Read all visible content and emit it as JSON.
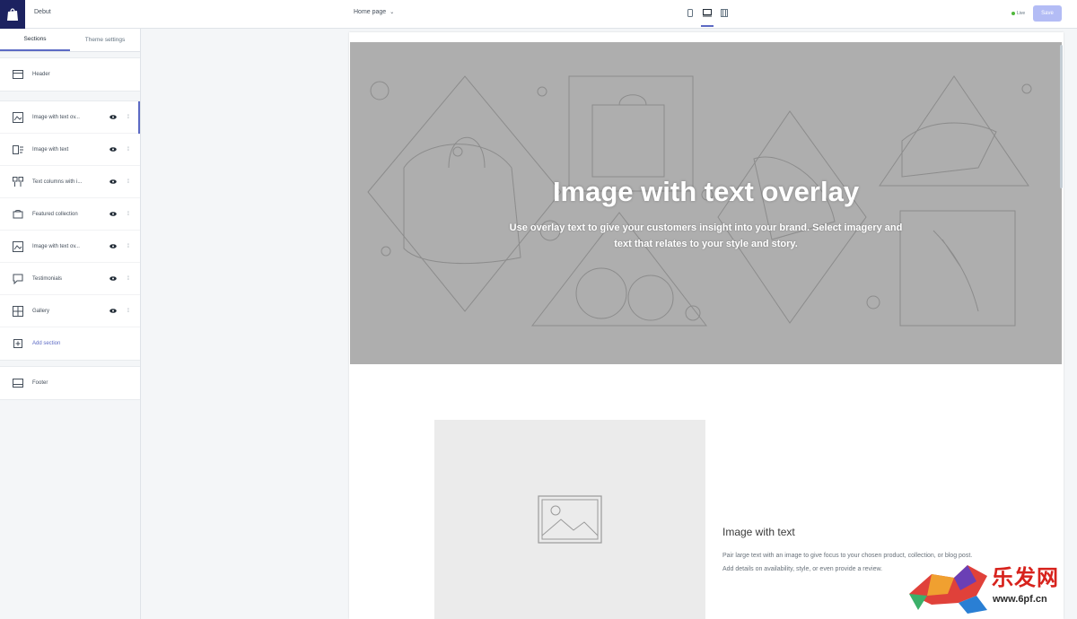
{
  "topbar": {
    "theme_name": "Debut",
    "page_select": "Home page",
    "status": "Live",
    "save_label": "Save",
    "devices": [
      "mobile-icon",
      "desktop-icon",
      "fullscreen-icon"
    ]
  },
  "sidebar": {
    "tabs": [
      "Sections",
      "Theme settings"
    ],
    "header": "Header",
    "sections": [
      {
        "label": "Image with text ov...",
        "icon": "image-text-overlay-icon"
      },
      {
        "label": "Image with text",
        "icon": "image-text-icon"
      },
      {
        "label": "Text columns with i...",
        "icon": "text-columns-icon"
      },
      {
        "label": "Featured collection",
        "icon": "collection-icon"
      },
      {
        "label": "Image with text ov...",
        "icon": "image-text-overlay-icon"
      },
      {
        "label": "Testimonials",
        "icon": "testimonials-icon"
      },
      {
        "label": "Gallery",
        "icon": "gallery-icon"
      }
    ],
    "add_section": "Add section",
    "footer": "Footer"
  },
  "preview": {
    "hero_title": "Image with text overlay",
    "hero_subtitle": "Use overlay text to give your customers insight into your brand. Select imagery and text that relates to your style and story.",
    "iwt_title": "Image with text",
    "iwt_body": "Pair large text with an image to give focus to your chosen product, collection, or blog post. Add details on availability, style, or even provide a review."
  },
  "watermark": {
    "cn": "乐发网",
    "url": "www.6pf.cn"
  },
  "colors": {
    "accent": "#5c6ac4",
    "logo_bg": "#1c2260",
    "hero_bg": "#aeaeae",
    "save_bg": "#b3bcf5"
  }
}
